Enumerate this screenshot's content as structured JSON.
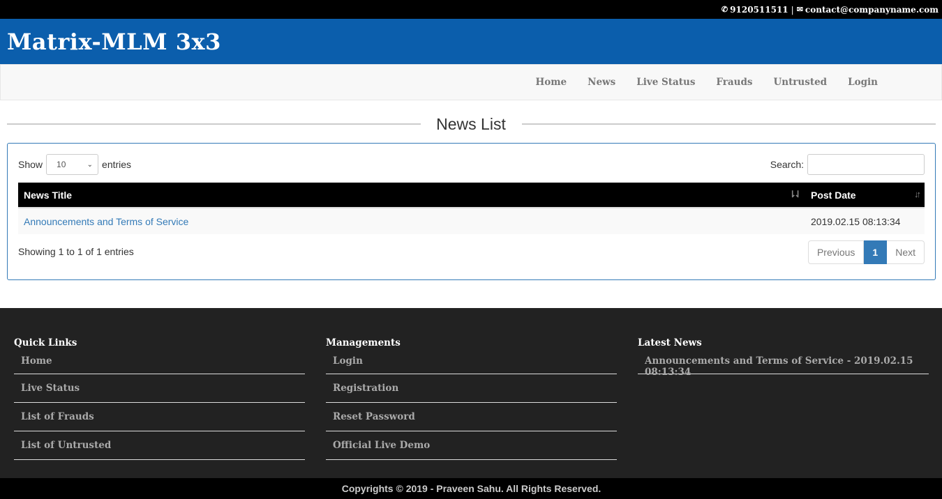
{
  "topbar": {
    "phone_icon": "phone-icon",
    "phone": "9120511511",
    "separator": "|",
    "email_icon": "envelope-icon",
    "email": "contact@companyname.com"
  },
  "brand": {
    "title": "Matrix-MLM 3x3"
  },
  "nav": {
    "items": [
      "Home",
      "News",
      "Live Status",
      "Frauds",
      "Untrusted",
      "Login"
    ]
  },
  "page": {
    "title": "News List"
  },
  "table_controls": {
    "show_label": "Show",
    "entries_label": "entries",
    "page_size": "10",
    "search_label": "Search:",
    "search_value": ""
  },
  "table": {
    "columns": [
      "News Title",
      "Post Date"
    ],
    "rows": [
      {
        "title": "Announcements and Terms of Service",
        "date": "2019.02.15 08:13:34"
      }
    ]
  },
  "pagination": {
    "info": "Showing 1 to 1 of 1 entries",
    "previous": "Previous",
    "current": "1",
    "next": "Next"
  },
  "footer": {
    "quick_links": {
      "heading": "Quick Links",
      "items": [
        "Home",
        "Live Status",
        "List of Frauds",
        "List of Untrusted"
      ]
    },
    "managements": {
      "heading": "Managements",
      "items": [
        "Login",
        "Registration",
        "Reset Password",
        "Official Live Demo"
      ]
    },
    "latest_news": {
      "heading": "Latest News",
      "items": [
        "Announcements and Terms of Service - 2019.02.15 08:13:34"
      ]
    },
    "copyright": "Copyrights © 2019 - Praveen Sahu. All Rights Reserved."
  },
  "colors": {
    "brand_blue": "#0b5eac",
    "link_blue": "#337ab7",
    "footer_bg": "#222222"
  }
}
